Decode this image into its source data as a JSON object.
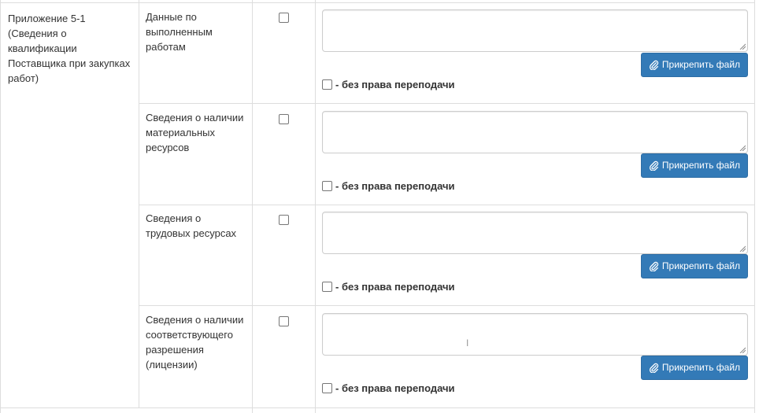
{
  "section": {
    "label": "Приложение 5-1 (Сведения о квалификации Поставщика при закупках работ)",
    "lines": [
      "Приложение 5-1",
      "(Сведения о",
      "квалификации",
      "Поставщика при закупках",
      "работ)"
    ]
  },
  "rows": [
    {
      "lines": [
        "Данные по",
        "выполненным",
        "работам"
      ],
      "textarea_value": "",
      "attach_label": "Прикрепить файл",
      "no_transfer_label": "- без права переподачи"
    },
    {
      "lines": [
        "Сведения о наличии",
        "материальных",
        "ресурсов"
      ],
      "textarea_value": "",
      "attach_label": "Прикрепить файл",
      "no_transfer_label": "- без права переподачи"
    },
    {
      "lines": [
        "Сведения о",
        "трудовых ресурсах"
      ],
      "textarea_value": "",
      "attach_label": "Прикрепить файл",
      "no_transfer_label": "- без права переподачи"
    },
    {
      "lines": [
        "Сведения о наличии",
        "соответствующего",
        "разрешения",
        "(лицензии)"
      ],
      "textarea_value": "",
      "attach_label": "Прикрепить файл",
      "no_transfer_label": "- без права переподачи"
    }
  ],
  "icons": {
    "attach": "paperclip-icon",
    "resize": "resize-handle-icon"
  },
  "colors": {
    "button": "#337ab7",
    "border": "#dddddd"
  }
}
